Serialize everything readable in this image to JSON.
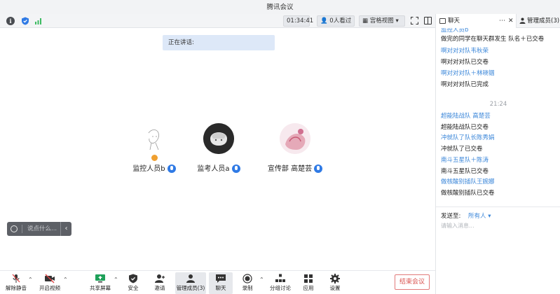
{
  "window": {
    "title": "腾讯会议"
  },
  "topbar": {
    "timer": "01:34:41",
    "viewers": "0人看过",
    "layout": "宫格视图"
  },
  "speaking": {
    "label": "正在讲话:"
  },
  "participants": [
    {
      "name": "监控人员b",
      "host": true
    },
    {
      "name": "监考人员a",
      "host": false
    },
    {
      "name": "宣传部 高楚芸",
      "host": false
    }
  ],
  "chat_input": {
    "placeholder": "说点什么..."
  },
  "toolbar": {
    "unmute": "解除静音",
    "video": "开启视频",
    "share": "共享屏幕",
    "security": "安全",
    "invite": "邀请",
    "members": "管理成员(3)",
    "chat": "聊天",
    "record": "录制",
    "breakout": "分组讨论",
    "apps": "应用",
    "settings": "设置",
    "end": "结束会议"
  },
  "chat_panel": {
    "tab_chat": "聊天",
    "tab_members": "管理成员(3)",
    "messages": [
      {
        "kind": "sender",
        "text": "监控人员b"
      },
      {
        "kind": "text",
        "text": "做完的同学在聊天群发生 队名＋已交卷"
      },
      {
        "kind": "sender",
        "text": "啊对对对队韦秋荣"
      },
      {
        "kind": "text",
        "text": "啊对对对队已交卷"
      },
      {
        "kind": "sender",
        "text": "啊对对对队＋林晓锢"
      },
      {
        "kind": "text",
        "text": "啊对对对队已完成"
      },
      {
        "kind": "time",
        "text": "21:24"
      },
      {
        "kind": "sender",
        "text": "超能陆战队 高楚芸"
      },
      {
        "kind": "text",
        "text": "超能陆战队已交卷"
      },
      {
        "kind": "sender",
        "text": "冲就队了队长陈秀娟"
      },
      {
        "kind": "text",
        "text": "冲就队了已交卷"
      },
      {
        "kind": "sender",
        "text": "南斗五星队＋陈涛"
      },
      {
        "kind": "text",
        "text": "南斗五星队已交卷"
      },
      {
        "kind": "sender",
        "text": "做核酸别插队王婉娜"
      },
      {
        "kind": "text",
        "text": "做核酸别插队已交卷"
      }
    ],
    "send_to_label": "发送至:",
    "send_target": "所有人",
    "input_placeholder": "请输入消息..."
  },
  "colors": {
    "accent": "#2f7ae5",
    "sender": "#3a86d9",
    "end_button": "#d9534f",
    "host_badge": "#f0a030"
  }
}
